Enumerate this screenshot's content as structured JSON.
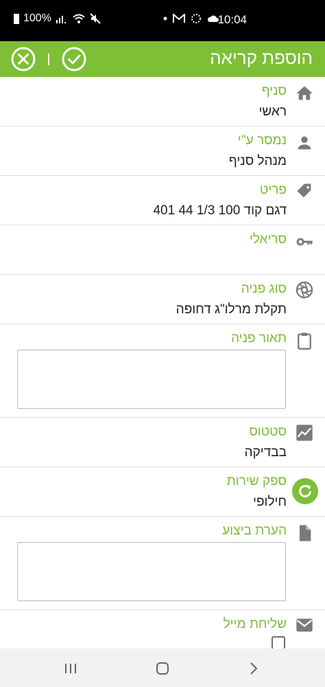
{
  "status_bar": {
    "battery": "100%",
    "time": "10:04"
  },
  "appbar": {
    "title": "הוספת קריאה",
    "icons": {
      "cancel": "close-circle-icon",
      "save": "check-circle-icon"
    }
  },
  "form": {
    "branch": {
      "label": "סניף",
      "value": "ראשי",
      "icon": "home-icon"
    },
    "delivered_by": {
      "label": "נמסר ע\"י",
      "value": "מנהל סניף",
      "icon": "person-icon"
    },
    "item": {
      "label": "פריט",
      "value": "דגם קוד 100 1/3 44 401",
      "icon": "tag-icon"
    },
    "serial": {
      "label": "סריאלי",
      "value": "",
      "icon": "key-icon"
    },
    "request_type": {
      "label": "סוג פניה",
      "value": "תקלת מרלו\"ג דחופה",
      "icon": "aperture-icon"
    },
    "description": {
      "label": "תאור פניה",
      "value": "",
      "icon": "clipboard-icon"
    },
    "status": {
      "label": "סטטוס",
      "value": "בבדיקה",
      "icon": "chart-icon"
    },
    "service_provider": {
      "label": "ספק שירות",
      "value": "חילופי",
      "icon": "refresh-icon"
    },
    "execution_note": {
      "label": "הערת ביצוע",
      "value": "",
      "icon": "document-icon"
    },
    "send_mail": {
      "label": "שליחת מייל",
      "checked": false,
      "icon": "mail-icon"
    }
  },
  "colors": {
    "accent": "#7dbf36",
    "label": "#7cbb38",
    "icon": "#7a7a7a"
  }
}
